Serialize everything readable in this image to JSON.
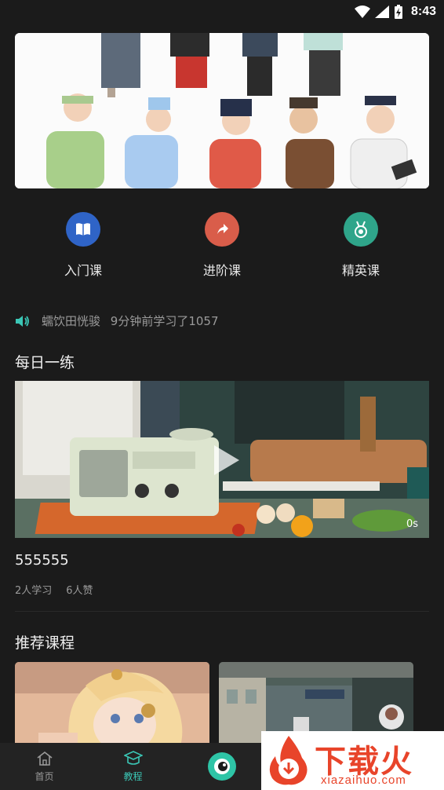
{
  "status": {
    "time": "8:43"
  },
  "categories": [
    {
      "label": "入门课",
      "color": "#2f64c7",
      "icon": "book-icon"
    },
    {
      "label": "进阶课",
      "color": "#d95d4a",
      "icon": "arrow-up-icon"
    },
    {
      "label": "精英课",
      "color": "#2fa58a",
      "icon": "medal-icon"
    }
  ],
  "notice": {
    "user": "蠕饮田恍骏",
    "text": "9分钟前学习了1057"
  },
  "daily": {
    "title": "每日一练",
    "video_title": "555555",
    "duration": "0s",
    "learners": "2人学习",
    "likes": "6人赞"
  },
  "recommended": {
    "title": "推荐课程"
  },
  "tabs": [
    {
      "label": "首页",
      "icon": "home-icon"
    },
    {
      "label": "教程",
      "icon": "graduation-cap-icon"
    },
    {
      "label": "",
      "icon": "camera-logo-icon"
    }
  ],
  "watermark": {
    "text": "下载火",
    "url": "xiazaihuo.com"
  },
  "colors": {
    "background": "#1b1b1b",
    "accent": "#3bc7b6"
  }
}
